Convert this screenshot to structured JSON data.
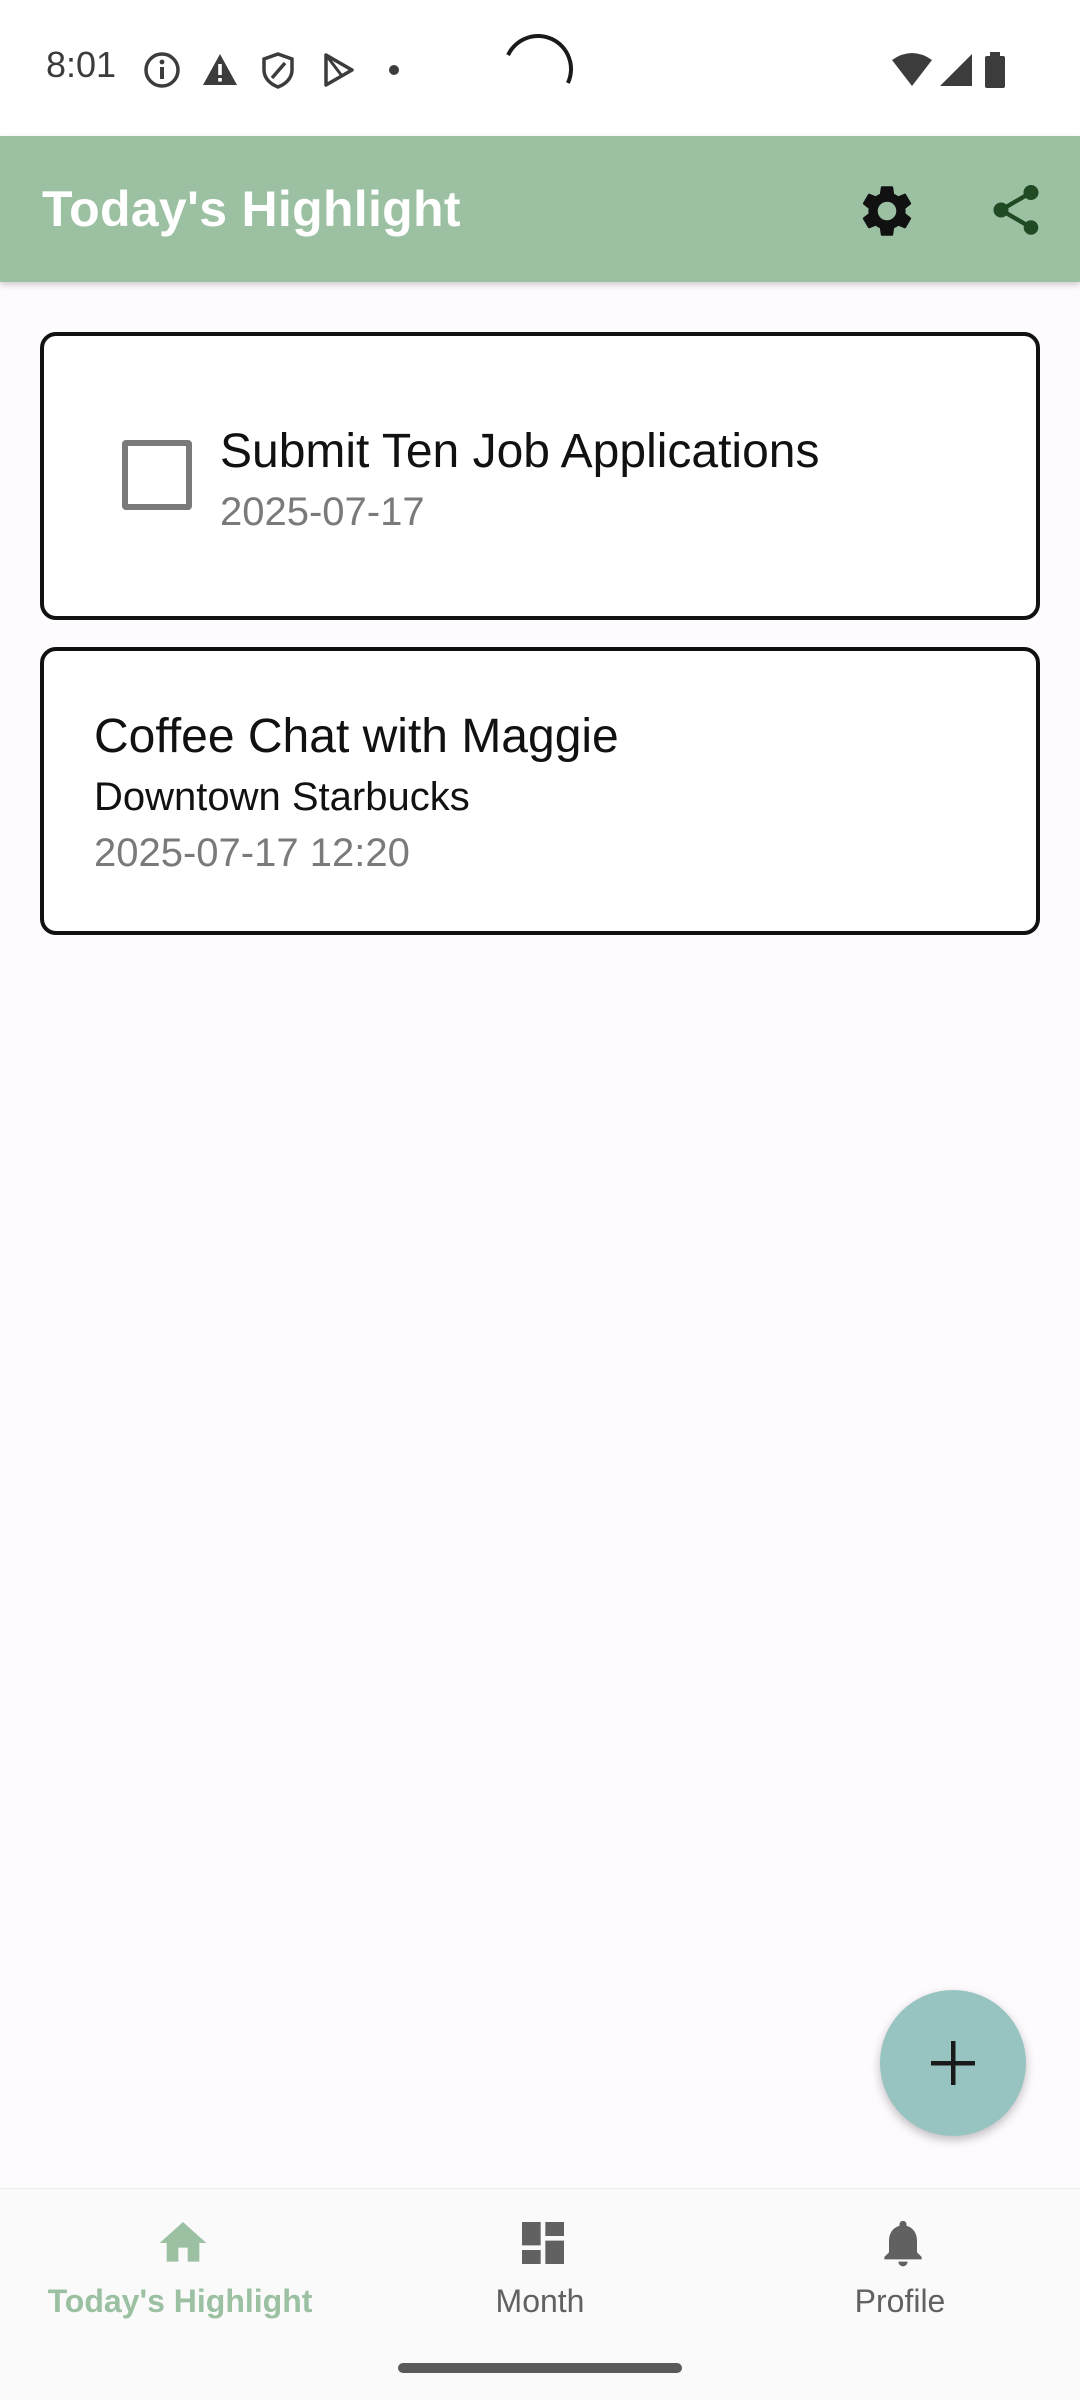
{
  "status_bar": {
    "time": "8:01"
  },
  "app_bar": {
    "title": "Today's Highlight"
  },
  "task": {
    "title": "Submit Ten Job Applications",
    "date": "2025-07-17",
    "checked": false
  },
  "event": {
    "title": "Coffee Chat with Maggie",
    "location": "Downtown Starbucks",
    "datetime": "2025-07-17 12:20"
  },
  "bottom_nav": {
    "items": [
      {
        "label": "Today's Highlight",
        "icon": "home-icon",
        "active": true
      },
      {
        "label": "Month",
        "icon": "dashboard-icon",
        "active": false
      },
      {
        "label": "Profile",
        "icon": "bell-icon",
        "active": false
      }
    ]
  },
  "colors": {
    "app_bar": "#9bc0a2",
    "fab": "#97c4c0",
    "nav_active": "#9bc0a2",
    "nav_inactive": "#616161"
  }
}
